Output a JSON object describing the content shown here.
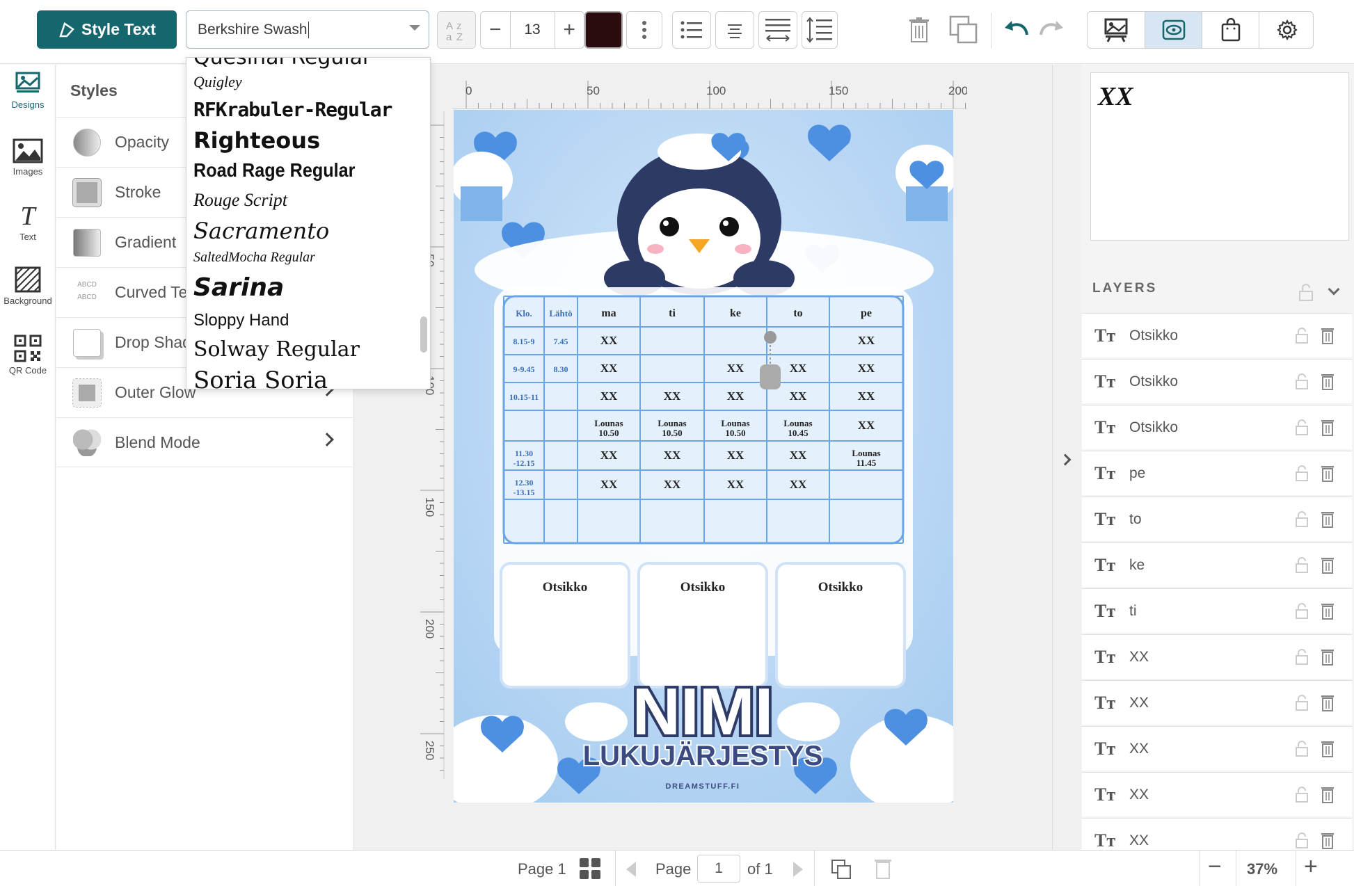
{
  "toolbar": {
    "style_text_label": "Style Text",
    "font_value": "Berkshire Swash",
    "font_size": "13",
    "text_color": "#2a0b0e",
    "accent": "#16666e"
  },
  "rail": {
    "items": [
      {
        "label": "Designs",
        "icon": "designs-icon"
      },
      {
        "label": "Images",
        "icon": "images-icon"
      },
      {
        "label": "Text",
        "icon": "text-icon"
      },
      {
        "label": "Background",
        "icon": "background-icon"
      },
      {
        "label": "QR Code",
        "icon": "qr-code-icon"
      }
    ]
  },
  "styles": {
    "title": "Styles",
    "items": [
      {
        "label": "Opacity"
      },
      {
        "label": "Stroke"
      },
      {
        "label": "Gradient"
      },
      {
        "label": "Curved Text"
      },
      {
        "label": "Drop Shadow"
      },
      {
        "label": "Outer Glow"
      },
      {
        "label": "Blend Mode"
      }
    ]
  },
  "font_list": [
    "Quesinal Regular",
    "Quigley",
    "RFKrabuler-Regular",
    "Righteous",
    "Road Rage Regular",
    "Rouge Script",
    "Sacramento",
    "SaltedMocha Regular",
    "Sarina",
    "Sloppy Hand",
    "Solway Regular",
    "Soria Soria"
  ],
  "rulers": {
    "top": [
      "0",
      "50",
      "100",
      "150",
      "200"
    ],
    "left": [
      "50",
      "100",
      "150",
      "200",
      "250"
    ]
  },
  "design": {
    "table_header": [
      "Klo.",
      "Lähtö",
      "ma",
      "ti",
      "ke",
      "to",
      "pe"
    ],
    "rows": [
      [
        "8.15-9",
        "7.45",
        "XX",
        "",
        "",
        "",
        "XX"
      ],
      [
        "9-9.45",
        "8.30",
        "XX",
        "",
        "XX",
        "XX",
        "XX"
      ],
      [
        "10.15-11",
        "",
        "XX",
        "XX",
        "XX",
        "XX",
        "XX"
      ],
      [
        "",
        "",
        "Lounas 10.50",
        "Lounas 10.50",
        "Lounas 10.50",
        "Lounas 10.45",
        "XX"
      ],
      [
        "11.30 -12.15",
        "",
        "XX",
        "XX",
        "XX",
        "XX",
        "Lounas 11.45"
      ],
      [
        "12.30 -13.15",
        "",
        "XX",
        "XX",
        "XX",
        "XX",
        ""
      ],
      [
        "",
        "",
        "",
        "",
        "",
        "",
        ""
      ]
    ],
    "boxes": [
      "Otsikko",
      "Otsikko",
      "Otsikko"
    ],
    "name": "NIMI",
    "subtitle": "LUKUJÄRJESTYS",
    "credit": "DREAMSTUFF.FI"
  },
  "preview_text": "XX",
  "layers": {
    "title": "LAYERS",
    "items": [
      "Otsikko",
      "Otsikko",
      "Otsikko",
      "pe",
      "to",
      "ke",
      "ti",
      "XX",
      "XX",
      "XX",
      "XX",
      "XX"
    ]
  },
  "bottom": {
    "page_label": "Page 1",
    "page_word": "Page",
    "page_number": "1",
    "of_label": "of 1",
    "zoom": "37%"
  }
}
